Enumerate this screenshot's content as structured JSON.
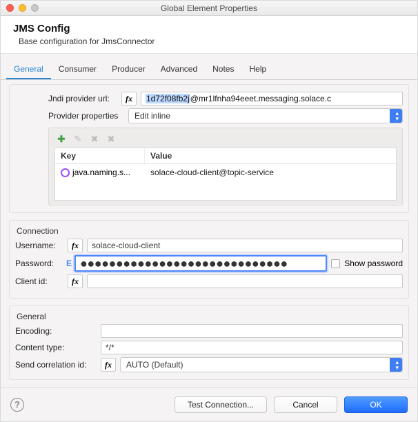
{
  "window": {
    "title": "Global Element Properties"
  },
  "header": {
    "title": "JMS Config",
    "subtitle": "Base configuration for JmsConnector"
  },
  "tabs": [
    "General",
    "Consumer",
    "Producer",
    "Advanced",
    "Notes",
    "Help"
  ],
  "jndi": {
    "url_label": "Jndi provider url:",
    "url_highlight": "1d72f08fb2j",
    "url_rest": "@mr1lfnha94eeet.messaging.solace.c",
    "provider_props_label": "Provider properties",
    "provider_props_value": "Edit inline",
    "table": {
      "headers": [
        "Key",
        "Value"
      ],
      "row": {
        "key": "java.naming.s...",
        "value": "solace-cloud-client@topic-service"
      }
    }
  },
  "connection": {
    "legend": "Connection",
    "username_label": "Username:",
    "username_value": "solace-cloud-client",
    "password_label": "Password:",
    "password_value": "●●●●●●●●●●●●●●●●●●●●●●●●●●●●●",
    "show_password_label": "Show password",
    "clientid_label": "Client id:",
    "clientid_value": ""
  },
  "general": {
    "legend": "General",
    "encoding_label": "Encoding:",
    "encoding_value": "",
    "content_type_label": "Content type:",
    "content_type_value": "*/*",
    "send_corr_label": "Send correlation id:",
    "send_corr_value": "AUTO (Default)"
  },
  "footer": {
    "test": "Test Connection...",
    "cancel": "Cancel",
    "ok": "OK"
  },
  "fx": "fx"
}
